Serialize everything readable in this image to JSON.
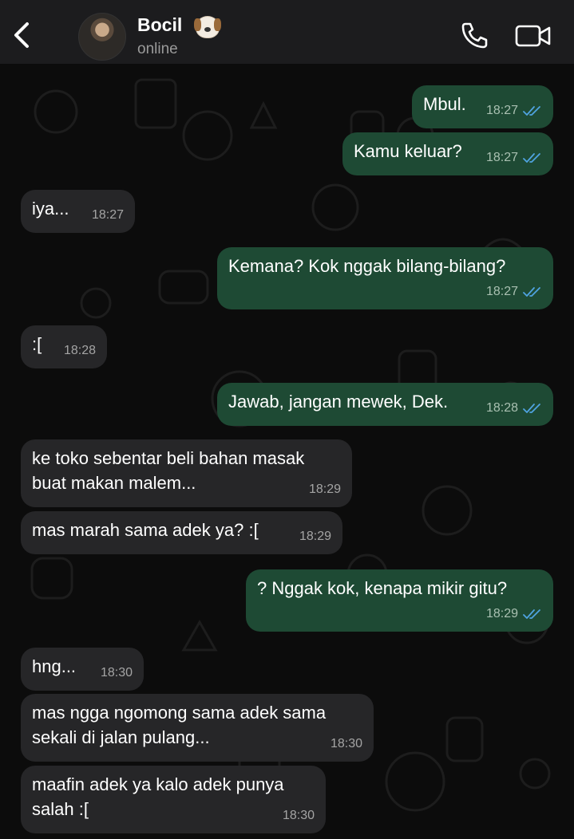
{
  "header": {
    "back_icon": "chevron-left-icon",
    "contact_name": "Bocil",
    "contact_emoji": "dog-face-emoji",
    "status": "online",
    "call_icon": "phone-icon",
    "video_icon": "video-camera-icon"
  },
  "colors": {
    "header_bg": "#1c1c1e",
    "outgoing_bubble": "#1e4a34",
    "incoming_bubble": "#262628",
    "read_tick": "#4fa3e0"
  },
  "messages": [
    {
      "dir": "out",
      "text": "Mbul.",
      "time": "18:27",
      "read": true
    },
    {
      "dir": "out",
      "text": "Kamu keluar?",
      "time": "18:27",
      "read": true
    },
    {
      "dir": "in",
      "text": "iya...",
      "time": "18:27"
    },
    {
      "dir": "out",
      "text": "Kemana? Kok nggak bilang-bilang?",
      "time": "18:27",
      "read": true
    },
    {
      "dir": "in",
      "text": ":[",
      "time": "18:28"
    },
    {
      "dir": "out",
      "text": "Jawab, jangan mewek, Dek.",
      "time": "18:28",
      "read": true
    },
    {
      "dir": "in",
      "text": "ke toko sebentar beli bahan masak\nbuat makan malem...",
      "time": "18:29"
    },
    {
      "dir": "in",
      "text": "mas marah sama adek ya? :[",
      "time": "18:29"
    },
    {
      "dir": "out",
      "text": "? Nggak kok, kenapa mikir gitu?",
      "time": "18:29",
      "read": true
    },
    {
      "dir": "in",
      "text": "hng...",
      "time": "18:30"
    },
    {
      "dir": "in",
      "text": "mas ngga ngomong sama adek sama\nsekali di jalan pulang...",
      "time": "18:30"
    },
    {
      "dir": "in",
      "text": "maafin adek ya kalo adek punya\nsalah :[",
      "time": "18:30"
    }
  ]
}
